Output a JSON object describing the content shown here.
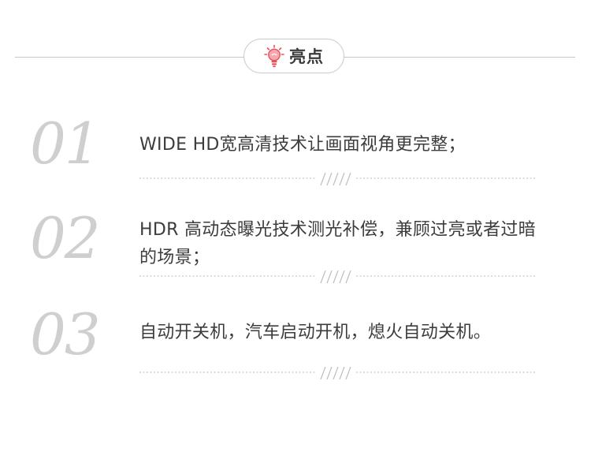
{
  "header": {
    "title": "亮点",
    "icon": "lightbulb-icon",
    "icon_color": "#e8505b",
    "line_color": "#c7c7c7"
  },
  "features": [
    {
      "number": "01",
      "text": "WIDE HD宽高清技术让画面视角更完整；"
    },
    {
      "number": "02",
      "text": "HDR 高动态曝光技术测光补偿，兼顾过亮或者过暗的场景；"
    },
    {
      "number": "03",
      "text": "自动开关机，汽车启动开机，熄火自动关机。"
    }
  ],
  "colors": {
    "number": "#cfcfcf",
    "text": "#3c3c3c",
    "divider": "#c8c8c8"
  }
}
